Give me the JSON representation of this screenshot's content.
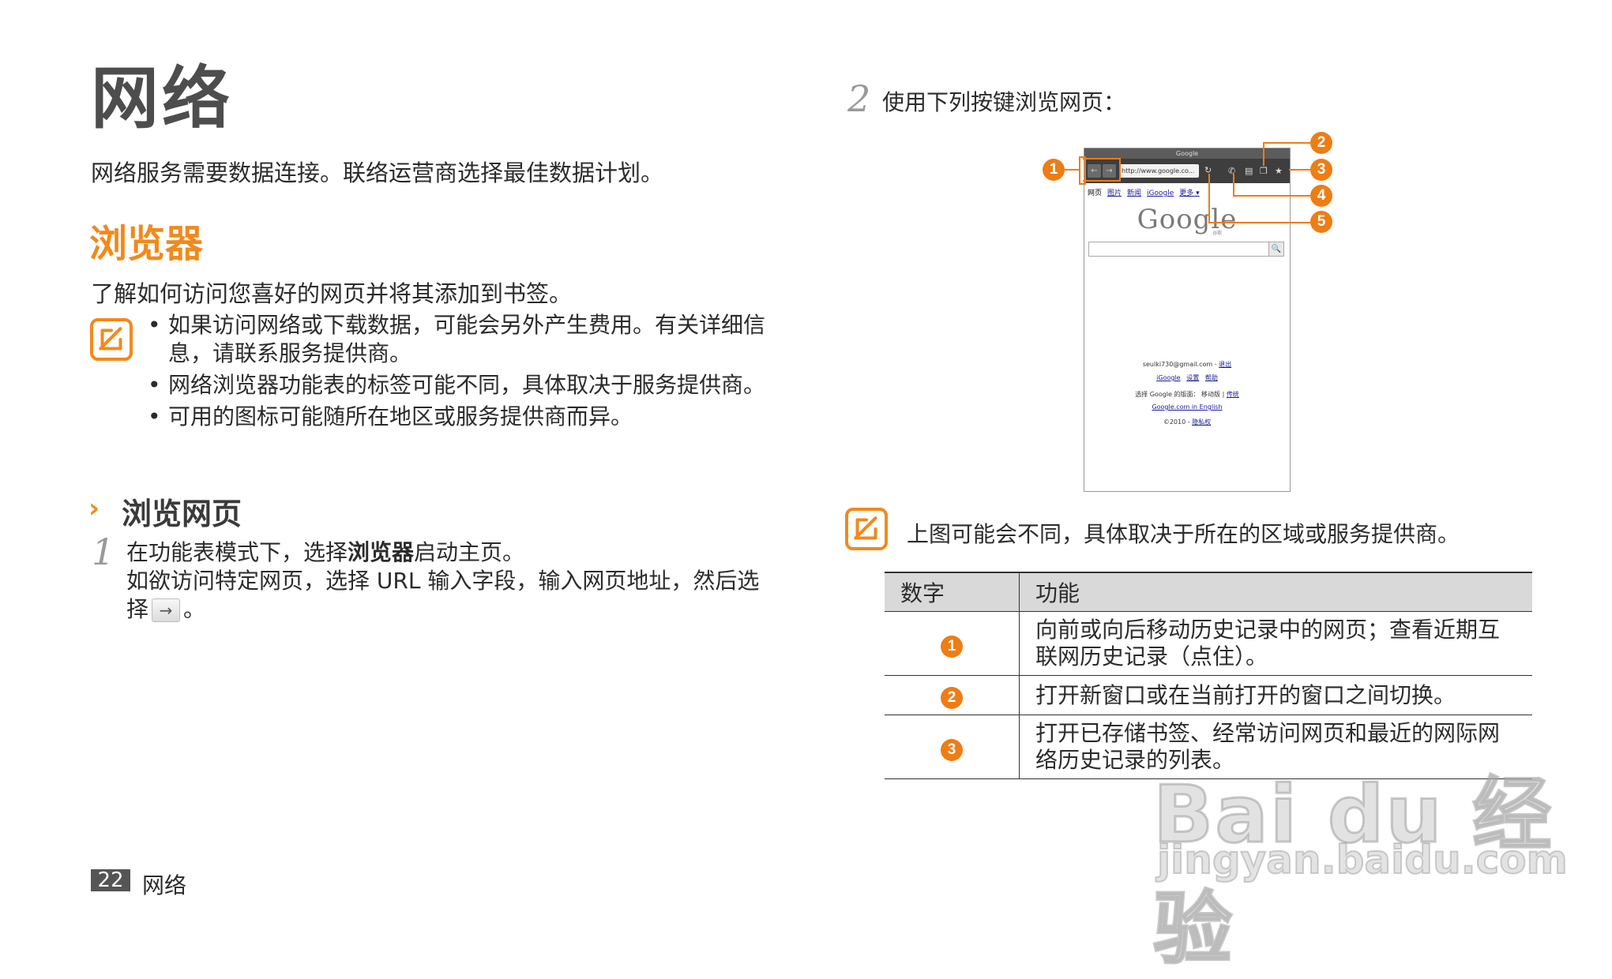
{
  "chapter": {
    "title": "网络",
    "intro": "网络服务需要数据连接。联络运营商选择最佳数据计划。"
  },
  "section": {
    "title": "浏览器",
    "intro": "了解如何访问您喜好的网页并将其添加到书签。",
    "notes": [
      "如果访问网络或下载数据，可能会另外产生费用。有关详细信息，请联系服务提供商。",
      "网络浏览器功能表的标签可能不同，具体取决于服务提供商。",
      "可用的图标可能随所在地区或服务提供商而异。"
    ]
  },
  "subsection": {
    "arrow": "›",
    "title": "浏览网页"
  },
  "steps": {
    "step1": {
      "num": "1",
      "pre": "在功能表模式下，选择",
      "bold": "浏览器",
      "post": "启动主页。",
      "line2_pre": "如欲访问特定网页，选择 URL 输入字段，输入网页地址，然后选择",
      "line2_post": "。",
      "go_glyph": "→"
    },
    "step2": {
      "num": "2",
      "text": "使用下列按键浏览网页："
    }
  },
  "phone": {
    "title": "Google",
    "url": "http://www.google.co...",
    "tabs": [
      "网页",
      "图片",
      "新闻",
      "iGoogle",
      "更多 ▾"
    ],
    "logo": "Google",
    "logo_sub": "谷歌",
    "search_glyph": "🔍",
    "footer": {
      "account": "seulki730@gmail.com",
      "logout": "退出",
      "links1": [
        "iGoogle",
        "设置",
        "帮助"
      ],
      "select_label": "选择 Google 的版面：",
      "mobile": "移动版",
      "classic": "传统",
      "english": "Google.com in English",
      "copyright": "©2010 -",
      "privacy": "隐私权"
    },
    "icons": {
      "back": "←",
      "forward": "→",
      "refresh": "↻",
      "phone": "✆",
      "list": "▤",
      "windows": "❐",
      "bookmark": "★"
    }
  },
  "callouts": [
    "1",
    "2",
    "3",
    "4",
    "5"
  ],
  "right_note": "上图可能会不同，具体取决于所在的区域或服务提供商。",
  "table": {
    "headers": [
      "数字",
      "功能"
    ],
    "rows": [
      {
        "num": "1",
        "text": "向前或向后移动历史记录中的网页；查看近期互联网历史记录（点住）。"
      },
      {
        "num": "2",
        "text": "打开新窗口或在当前打开的窗口之间切换。"
      },
      {
        "num": "3",
        "text": "打开已存储书签、经常访问网页和最近的网际网络历史记录的列表。"
      }
    ]
  },
  "footer": {
    "page": "22",
    "label": "网络"
  },
  "watermark": {
    "main": "Bai du 经验",
    "url": "jingyan.baidu.com"
  },
  "colors": {
    "accent": "#f08a1c",
    "callout": "#ee7d14",
    "table_header": "#d9d9d9"
  }
}
